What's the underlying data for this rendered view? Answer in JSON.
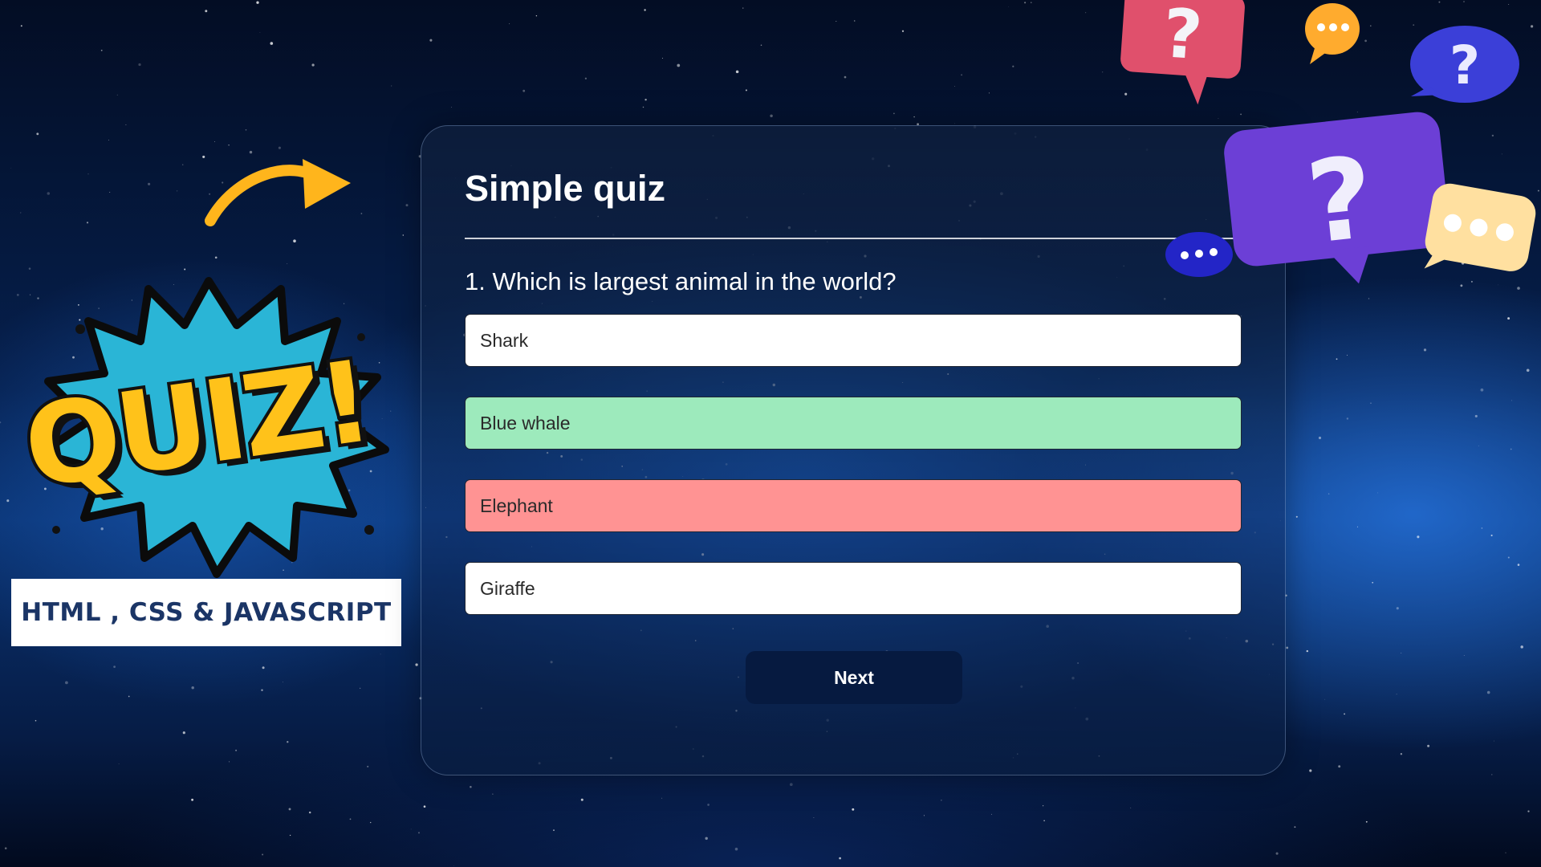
{
  "decor": {
    "quiz_logo_text": "QUIZ!",
    "tech_label": "HTML , CSS & JAVASCRIPT"
  },
  "quiz": {
    "title": "Simple quiz",
    "question": "1. Which is largest animal in the world?",
    "answers": [
      {
        "label": "Shark",
        "state": "default"
      },
      {
        "label": "Blue whale",
        "state": "correct"
      },
      {
        "label": "Elephant",
        "state": "wrong"
      },
      {
        "label": "Giraffe",
        "state": "default"
      }
    ],
    "next_label": "Next"
  },
  "bubbles": {
    "glyph_question": "?"
  },
  "colors": {
    "correct": "#9deabc",
    "wrong": "#ff9393",
    "button": "#061a40",
    "quiz_yellow": "#ffc21a",
    "label_text": "#1b3566"
  }
}
